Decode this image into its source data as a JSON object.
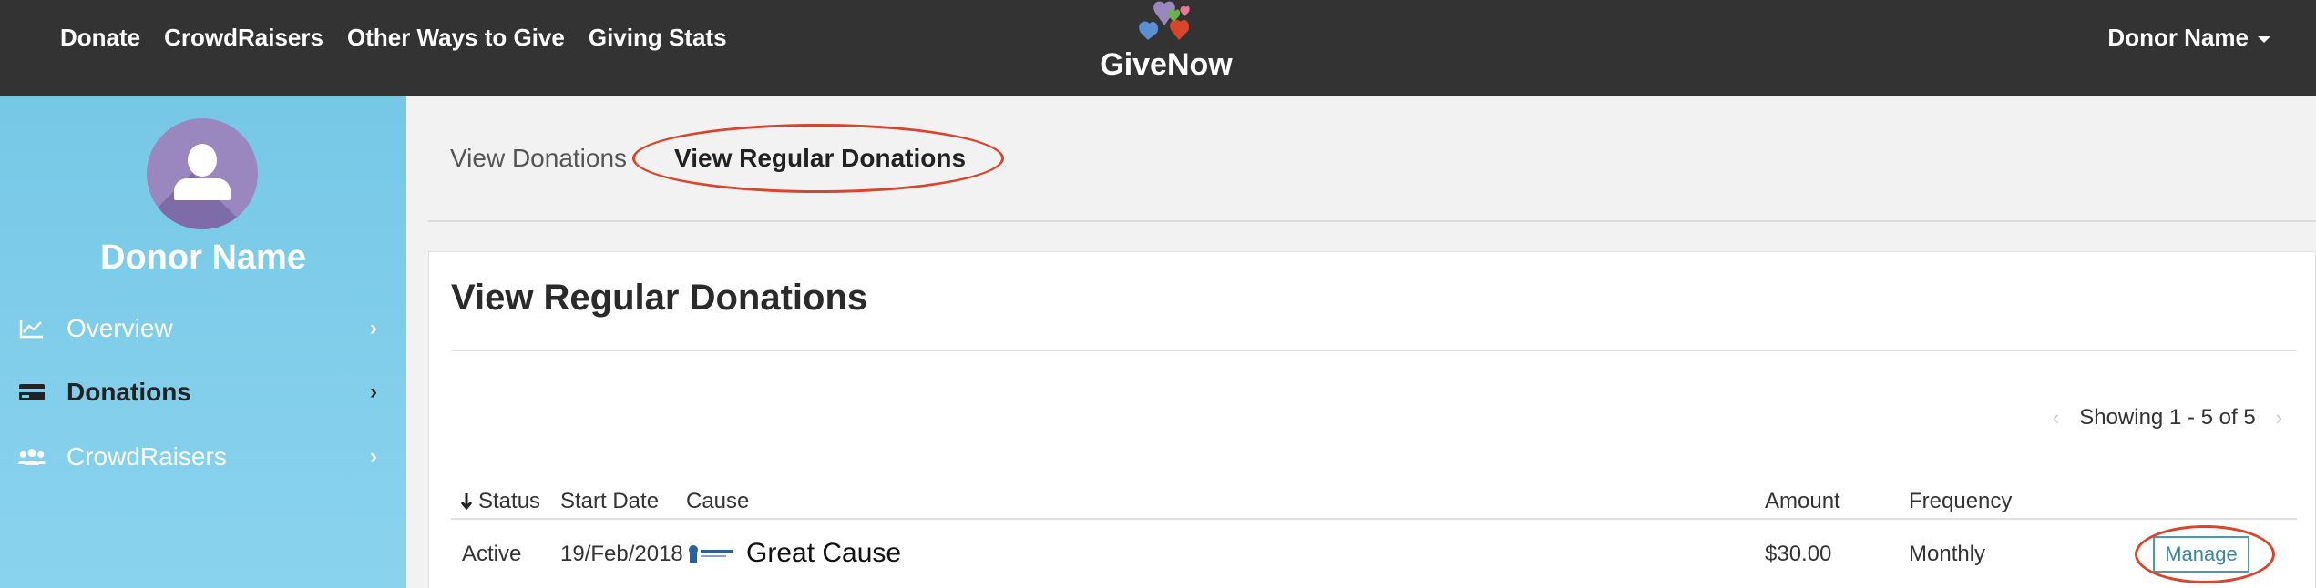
{
  "topnav": {
    "items": [
      "Donate",
      "CrowdRaisers",
      "Other Ways to Give",
      "Giving Stats"
    ],
    "logo_text": "GiveNow",
    "user_menu": "Donor Name"
  },
  "sidebar": {
    "donor_name": "Donor Name",
    "items": [
      {
        "label": "Overview",
        "icon": "chart-line-icon",
        "active": false
      },
      {
        "label": "Donations",
        "icon": "credit-card-icon",
        "active": true
      },
      {
        "label": "CrowdRaisers",
        "icon": "users-icon",
        "active": false
      }
    ]
  },
  "tabs": {
    "view_donations": "View Donations",
    "view_regular_donations": "View Regular Donations"
  },
  "panel": {
    "title": "View Regular Donations",
    "pager_text": "Showing 1 - 5 of 5",
    "columns": {
      "status": "Status",
      "start_date": "Start Date",
      "cause": "Cause",
      "amount": "Amount",
      "frequency": "Frequency"
    },
    "rows": [
      {
        "status": "Active",
        "start_date": "19/Feb/2018",
        "cause": "Great Cause",
        "amount": "$30.00",
        "frequency": "Monthly",
        "action": "Manage"
      }
    ]
  },
  "colors": {
    "topbar": "#333333",
    "sidebar": "#80cdeb",
    "highlight": "#d9442a",
    "manage": "#3a87a0"
  }
}
